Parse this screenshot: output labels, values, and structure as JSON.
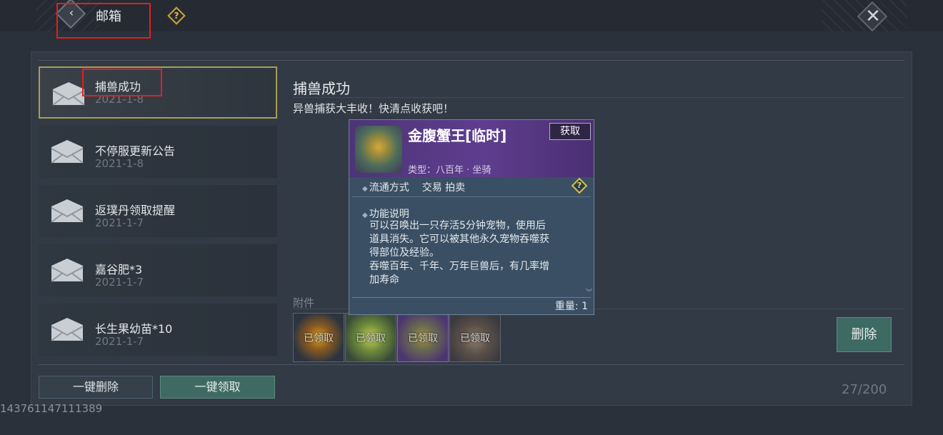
{
  "header": {
    "title": "邮箱",
    "help_glyph": "?",
    "close_glyph": "✕",
    "back_glyph": "‹"
  },
  "mail_list": [
    {
      "title": "捕兽成功",
      "date": "2021-1-8"
    },
    {
      "title": "不停服更新公告",
      "date": "2021-1-8"
    },
    {
      "title": "返璞丹领取提醒",
      "date": "2021-1-7"
    },
    {
      "title": "嘉谷肥*3",
      "date": "2021-1-7"
    },
    {
      "title": "长生果幼苗*10",
      "date": "2021-1-7"
    }
  ],
  "detail": {
    "title": "捕兽成功",
    "body": "异兽捕获大丰收！快清点收获吧！",
    "attachments_label": "附件",
    "attachments": [
      {
        "status": "已领取"
      },
      {
        "status": "已领取"
      },
      {
        "status": "已领取"
      },
      {
        "status": "已领取"
      }
    ],
    "delete_label": "删除"
  },
  "tooltip": {
    "name": "金腹蟹王[临时]",
    "get_label": "获取",
    "type_line": "类型：八百年 · 坐骑",
    "circulation_label": "流通方式",
    "circulation_values": "交易 拍卖",
    "function_label": "功能说明",
    "description_lines": [
      "可以召唤出一只存活5分钟宠物，使用后",
      "道具消失。它可以被其他永久宠物吞噬获",
      "得部位及经验。",
      "吞噬百年、千年、万年巨兽后，有几率增",
      "加寿命"
    ],
    "weight": "重量: 1"
  },
  "footer": {
    "delete_all_label": "一键删除",
    "claim_all_label": "一键领取",
    "count": "27/200",
    "uid": "143761147111389"
  },
  "colors": {
    "selected_border": "#a59e58",
    "claim_button": "#3f6a62",
    "tooltip_header": "#5e3d8e",
    "highlight_red": "#e02020"
  }
}
